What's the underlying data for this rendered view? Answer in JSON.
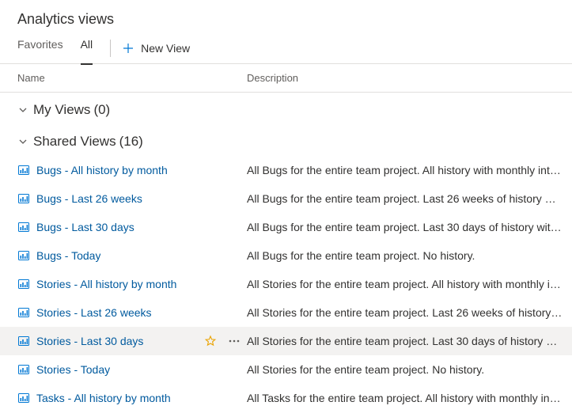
{
  "header": {
    "title": "Analytics views"
  },
  "tabs": {
    "favorites": "Favorites",
    "all": "All",
    "newView": "New View"
  },
  "columns": {
    "name": "Name",
    "description": "Description"
  },
  "groups": {
    "myViews": {
      "label": "My Views",
      "count": "(0)"
    },
    "sharedViews": {
      "label": "Shared Views",
      "count": "(16)"
    }
  },
  "sharedItems": [
    {
      "name": "Bugs - All history by month",
      "desc": "All Bugs for the entire team project. All history with monthly int…"
    },
    {
      "name": "Bugs - Last 26 weeks",
      "desc": "All Bugs for the entire team project. Last 26 weeks of history wi…"
    },
    {
      "name": "Bugs - Last 30 days",
      "desc": "All Bugs for the entire team project. Last 30 days of history wit…"
    },
    {
      "name": "Bugs - Today",
      "desc": "All Bugs for the entire team project. No history."
    },
    {
      "name": "Stories - All history by month",
      "desc": "All Stories for the entire team project. All history with monthly i…"
    },
    {
      "name": "Stories - Last 26 weeks",
      "desc": "All Stories for the entire team project. Last 26 weeks of history…"
    },
    {
      "name": "Stories - Last 30 days",
      "desc": "All Stories for the entire team project. Last 30 days of history wi…",
      "hovered": true
    },
    {
      "name": "Stories - Today",
      "desc": "All Stories for the entire team project. No history."
    },
    {
      "name": "Tasks - All history by month",
      "desc": "All Tasks for the entire team project. All history with monthly in…"
    }
  ]
}
